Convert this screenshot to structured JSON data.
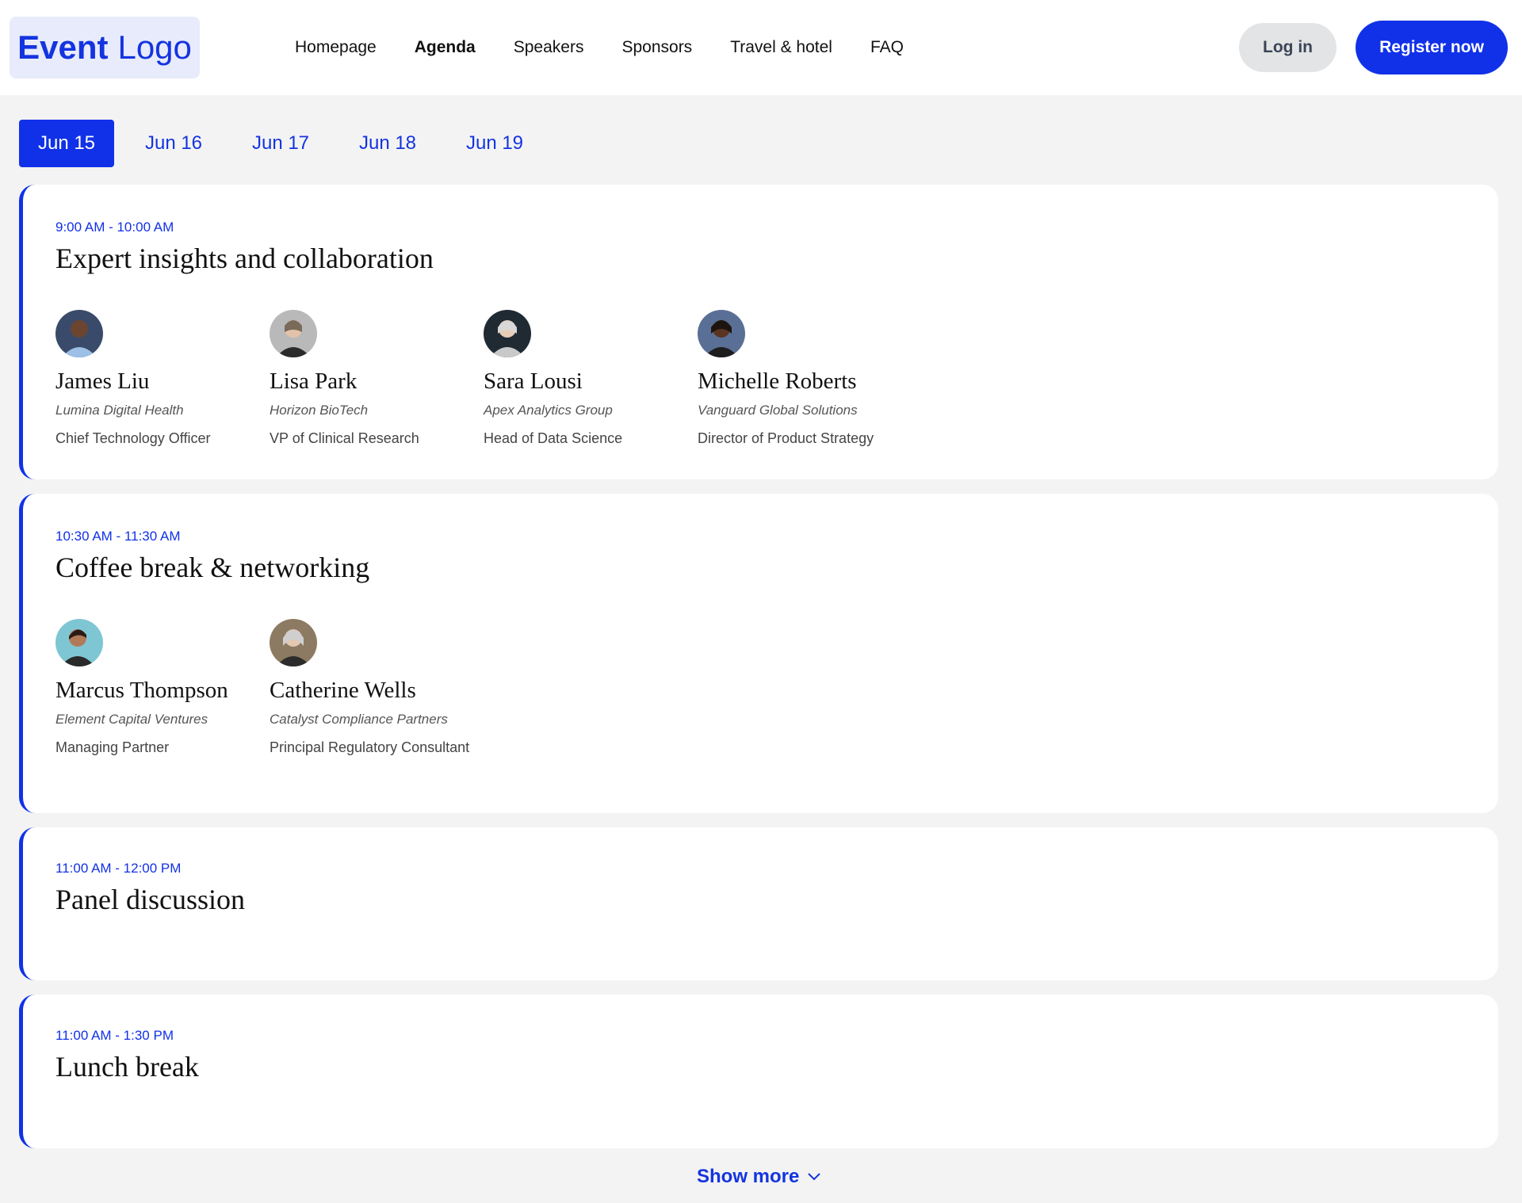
{
  "header": {
    "logo": {
      "bold": "Event",
      "regular": "Logo"
    },
    "nav": [
      {
        "label": "Homepage",
        "active": false
      },
      {
        "label": "Agenda",
        "active": true
      },
      {
        "label": "Speakers",
        "active": false
      },
      {
        "label": "Sponsors",
        "active": false
      },
      {
        "label": "Travel & hotel",
        "active": false
      },
      {
        "label": "FAQ",
        "active": false
      }
    ],
    "login_label": "Log in",
    "register_label": "Register now"
  },
  "date_tabs": [
    {
      "label": "Jun 15",
      "active": true
    },
    {
      "label": "Jun 16",
      "active": false
    },
    {
      "label": "Jun 17",
      "active": false
    },
    {
      "label": "Jun 18",
      "active": false
    },
    {
      "label": "Jun 19",
      "active": false
    }
  ],
  "sessions": [
    {
      "time": "9:00 AM - 10:00 AM",
      "title": "Expert insights and collaboration",
      "speakers": [
        {
          "name": "James Liu",
          "org": "Lumina Digital Health",
          "role": "Chief Technology Officer"
        },
        {
          "name": "Lisa Park",
          "org": "Horizon BioTech",
          "role": "VP of Clinical Research"
        },
        {
          "name": "Sara Lousi",
          "org": "Apex Analytics Group",
          "role": "Head of Data Science"
        },
        {
          "name": "Michelle Roberts",
          "org": "Vanguard Global Solutions",
          "role": "Director of Product Strategy"
        }
      ]
    },
    {
      "time": "10:30 AM - 11:30 AM",
      "title": "Coffee break & networking",
      "speakers": [
        {
          "name": "Marcus Thompson",
          "org": "Element Capital Ventures",
          "role": "Managing Partner"
        },
        {
          "name": "Catherine Wells",
          "org": "Catalyst Compliance Partners",
          "role": "Principal Regulatory Consultant"
        }
      ]
    },
    {
      "time": "11:00 AM - 12:00 PM",
      "title": "Panel discussion",
      "speakers": []
    },
    {
      "time": "11:00 AM - 1:30 PM",
      "title": "Lunch break",
      "speakers": []
    }
  ],
  "show_more_label": "Show more",
  "colors": {
    "accent": "#1131e8",
    "background": "#f3f3f3",
    "logo_bg": "#e8ebfb",
    "login_bg": "#e2e4e6"
  }
}
